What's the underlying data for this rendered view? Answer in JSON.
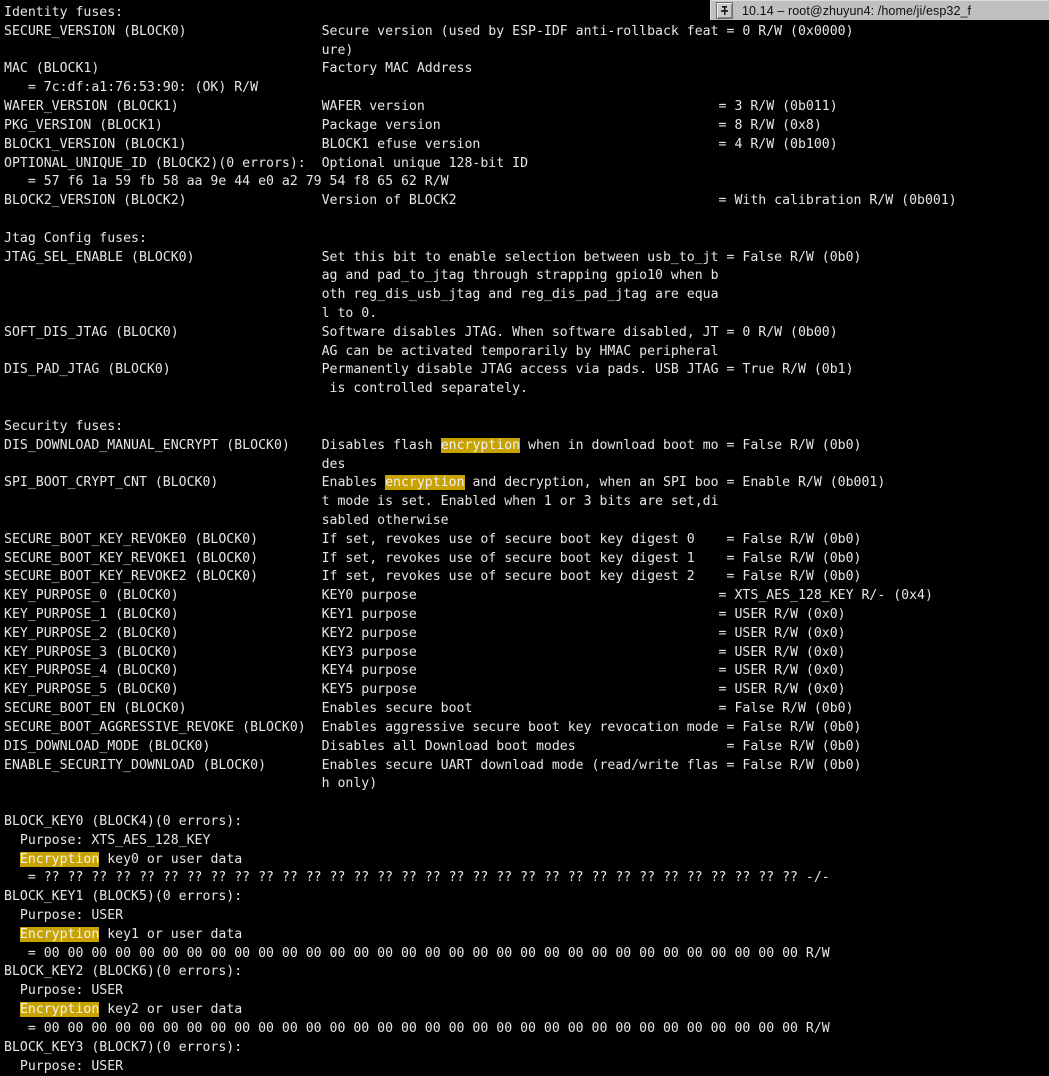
{
  "window": {
    "title": "10.14 – root@zhuyun4: /home/ji/esp32_f",
    "pin_icon": "pin-icon",
    "titlebar_bg": "#c0c0c0"
  },
  "terminal": {
    "bg": "#000000",
    "fg": "#e6e6e6",
    "highlight_bg": "#c8a200",
    "highlight_fg": "#f2f2f2",
    "highlight_terms": [
      "encryption",
      "Encryption"
    ],
    "cols": 129,
    "col2_start": 41,
    "col3_start": 92,
    "lines": [
      "Identity fuses:",
      "SECURE_VERSION (BLOCK0)                 Secure version (used by ESP-IDF anti-rollback feat = 0 R/W (0x0000)",
      "                                        ure)",
      "MAC (BLOCK1)                            Factory MAC Address",
      "   = 7c:df:a1:76:53:90: (OK) R/W",
      "WAFER_VERSION (BLOCK1)                  WAFER version                                     = 3 R/W (0b011)",
      "PKG_VERSION (BLOCK1)                    Package version                                   = 8 R/W (0x8)",
      "BLOCK1_VERSION (BLOCK1)                 BLOCK1 efuse version                              = 4 R/W (0b100)",
      "OPTIONAL_UNIQUE_ID (BLOCK2)(0 errors):  Optional unique 128-bit ID",
      "   = 57 f6 1a 59 fb 58 aa 9e 44 e0 a2 79 54 f8 65 62 R/W",
      "BLOCK2_VERSION (BLOCK2)                 Version of BLOCK2                                 = With calibration R/W (0b001)",
      "",
      "Jtag Config fuses:",
      "JTAG_SEL_ENABLE (BLOCK0)                Set this bit to enable selection between usb_to_jt = False R/W (0b0)",
      "                                        ag and pad_to_jtag through strapping gpio10 when b",
      "                                        oth reg_dis_usb_jtag and reg_dis_pad_jtag are equa",
      "                                        l to 0.",
      "SOFT_DIS_JTAG (BLOCK0)                  Software disables JTAG. When software disabled, JT = 0 R/W (0b00)",
      "                                        AG can be activated temporarily by HMAC peripheral",
      "DIS_PAD_JTAG (BLOCK0)                   Permanently disable JTAG access via pads. USB JTAG = True R/W (0b1)",
      "                                         is controlled separately.",
      "",
      "Security fuses:",
      "DIS_DOWNLOAD_MANUAL_ENCRYPT (BLOCK0)    Disables flash encryption when in download boot mo = False R/W (0b0)",
      "                                        des",
      "SPI_BOOT_CRYPT_CNT (BLOCK0)             Enables encryption and decryption, when an SPI boo = Enable R/W (0b001)",
      "                                        t mode is set. Enabled when 1 or 3 bits are set,di",
      "                                        sabled otherwise",
      "SECURE_BOOT_KEY_REVOKE0 (BLOCK0)        If set, revokes use of secure boot key digest 0    = False R/W (0b0)",
      "SECURE_BOOT_KEY_REVOKE1 (BLOCK0)        If set, revokes use of secure boot key digest 1    = False R/W (0b0)",
      "SECURE_BOOT_KEY_REVOKE2 (BLOCK0)        If set, revokes use of secure boot key digest 2    = False R/W (0b0)",
      "KEY_PURPOSE_0 (BLOCK0)                  KEY0 purpose                                      = XTS_AES_128_KEY R/- (0x4)",
      "KEY_PURPOSE_1 (BLOCK0)                  KEY1 purpose                                      = USER R/W (0x0)",
      "KEY_PURPOSE_2 (BLOCK0)                  KEY2 purpose                                      = USER R/W (0x0)",
      "KEY_PURPOSE_3 (BLOCK0)                  KEY3 purpose                                      = USER R/W (0x0)",
      "KEY_PURPOSE_4 (BLOCK0)                  KEY4 purpose                                      = USER R/W (0x0)",
      "KEY_PURPOSE_5 (BLOCK0)                  KEY5 purpose                                      = USER R/W (0x0)",
      "SECURE_BOOT_EN (BLOCK0)                 Enables secure boot                               = False R/W (0b0)",
      "SECURE_BOOT_AGGRESSIVE_REVOKE (BLOCK0)  Enables aggressive secure boot key revocation mode = False R/W (0b0)",
      "DIS_DOWNLOAD_MODE (BLOCK0)              Disables all Download boot modes                   = False R/W (0b0)",
      "ENABLE_SECURITY_DOWNLOAD (BLOCK0)       Enables secure UART download mode (read/write flas = False R/W (0b0)",
      "                                        h only)",
      "",
      "BLOCK_KEY0 (BLOCK4)(0 errors):",
      "  Purpose: XTS_AES_128_KEY",
      "  Encryption key0 or user data",
      "   = ?? ?? ?? ?? ?? ?? ?? ?? ?? ?? ?? ?? ?? ?? ?? ?? ?? ?? ?? ?? ?? ?? ?? ?? ?? ?? ?? ?? ?? ?? ?? ?? -/-",
      "BLOCK_KEY1 (BLOCK5)(0 errors):",
      "  Purpose: USER",
      "  Encryption key1 or user data",
      "   = 00 00 00 00 00 00 00 00 00 00 00 00 00 00 00 00 00 00 00 00 00 00 00 00 00 00 00 00 00 00 00 00 R/W",
      "BLOCK_KEY2 (BLOCK6)(0 errors):",
      "  Purpose: USER",
      "  Encryption key2 or user data",
      "   = 00 00 00 00 00 00 00 00 00 00 00 00 00 00 00 00 00 00 00 00 00 00 00 00 00 00 00 00 00 00 00 00 R/W",
      "BLOCK_KEY3 (BLOCK7)(0 errors):",
      "  Purpose: USER"
    ]
  }
}
